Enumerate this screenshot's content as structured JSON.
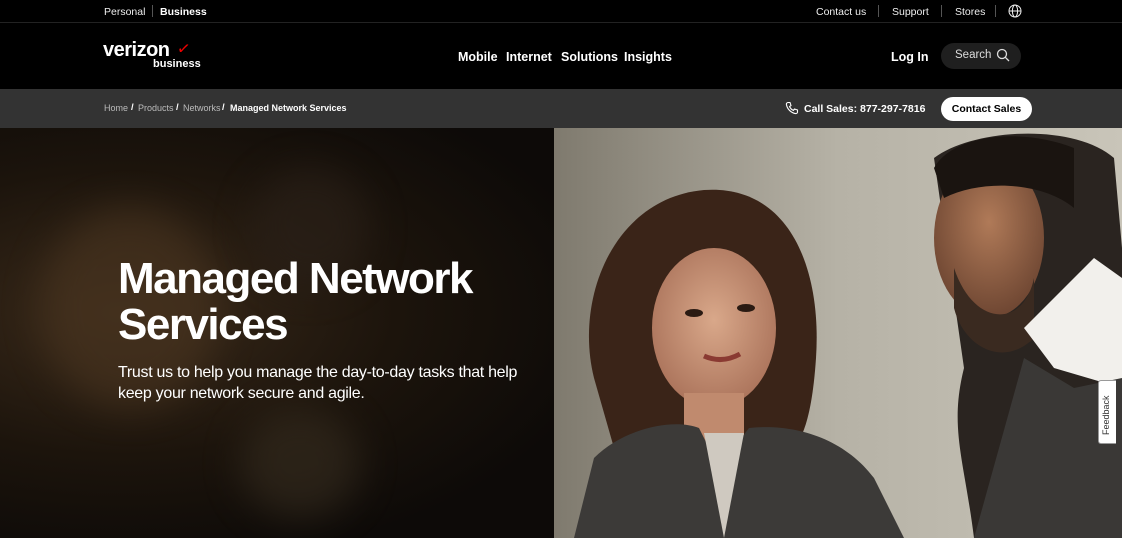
{
  "utility": {
    "segments": [
      "Personal",
      "Business"
    ],
    "links": [
      "Contact us",
      "Support",
      "Stores"
    ],
    "globe_icon": "globe-icon"
  },
  "header": {
    "logo_word": "verizon",
    "logo_check": "✓",
    "logo_sub": "business",
    "nav": [
      "Mobile",
      "Internet",
      "Solutions",
      "Insights"
    ],
    "login": "Log In",
    "search_label": "Search"
  },
  "subbar": {
    "breadcrumb": [
      "Home",
      "Products",
      "Networks",
      "Managed Network Services"
    ],
    "call_label": "Call Sales: 877-297-7816",
    "contact_button": "Contact Sales"
  },
  "hero": {
    "title": "Managed Network Services",
    "subtitle": "Trust us to help you manage the day-to-day tasks that help keep your network secure and agile."
  },
  "feedback": {
    "label": "Feedback"
  },
  "colors": {
    "brand_red": "#ee0000",
    "subbar_bg": "#333333",
    "header_bg": "#000000"
  }
}
